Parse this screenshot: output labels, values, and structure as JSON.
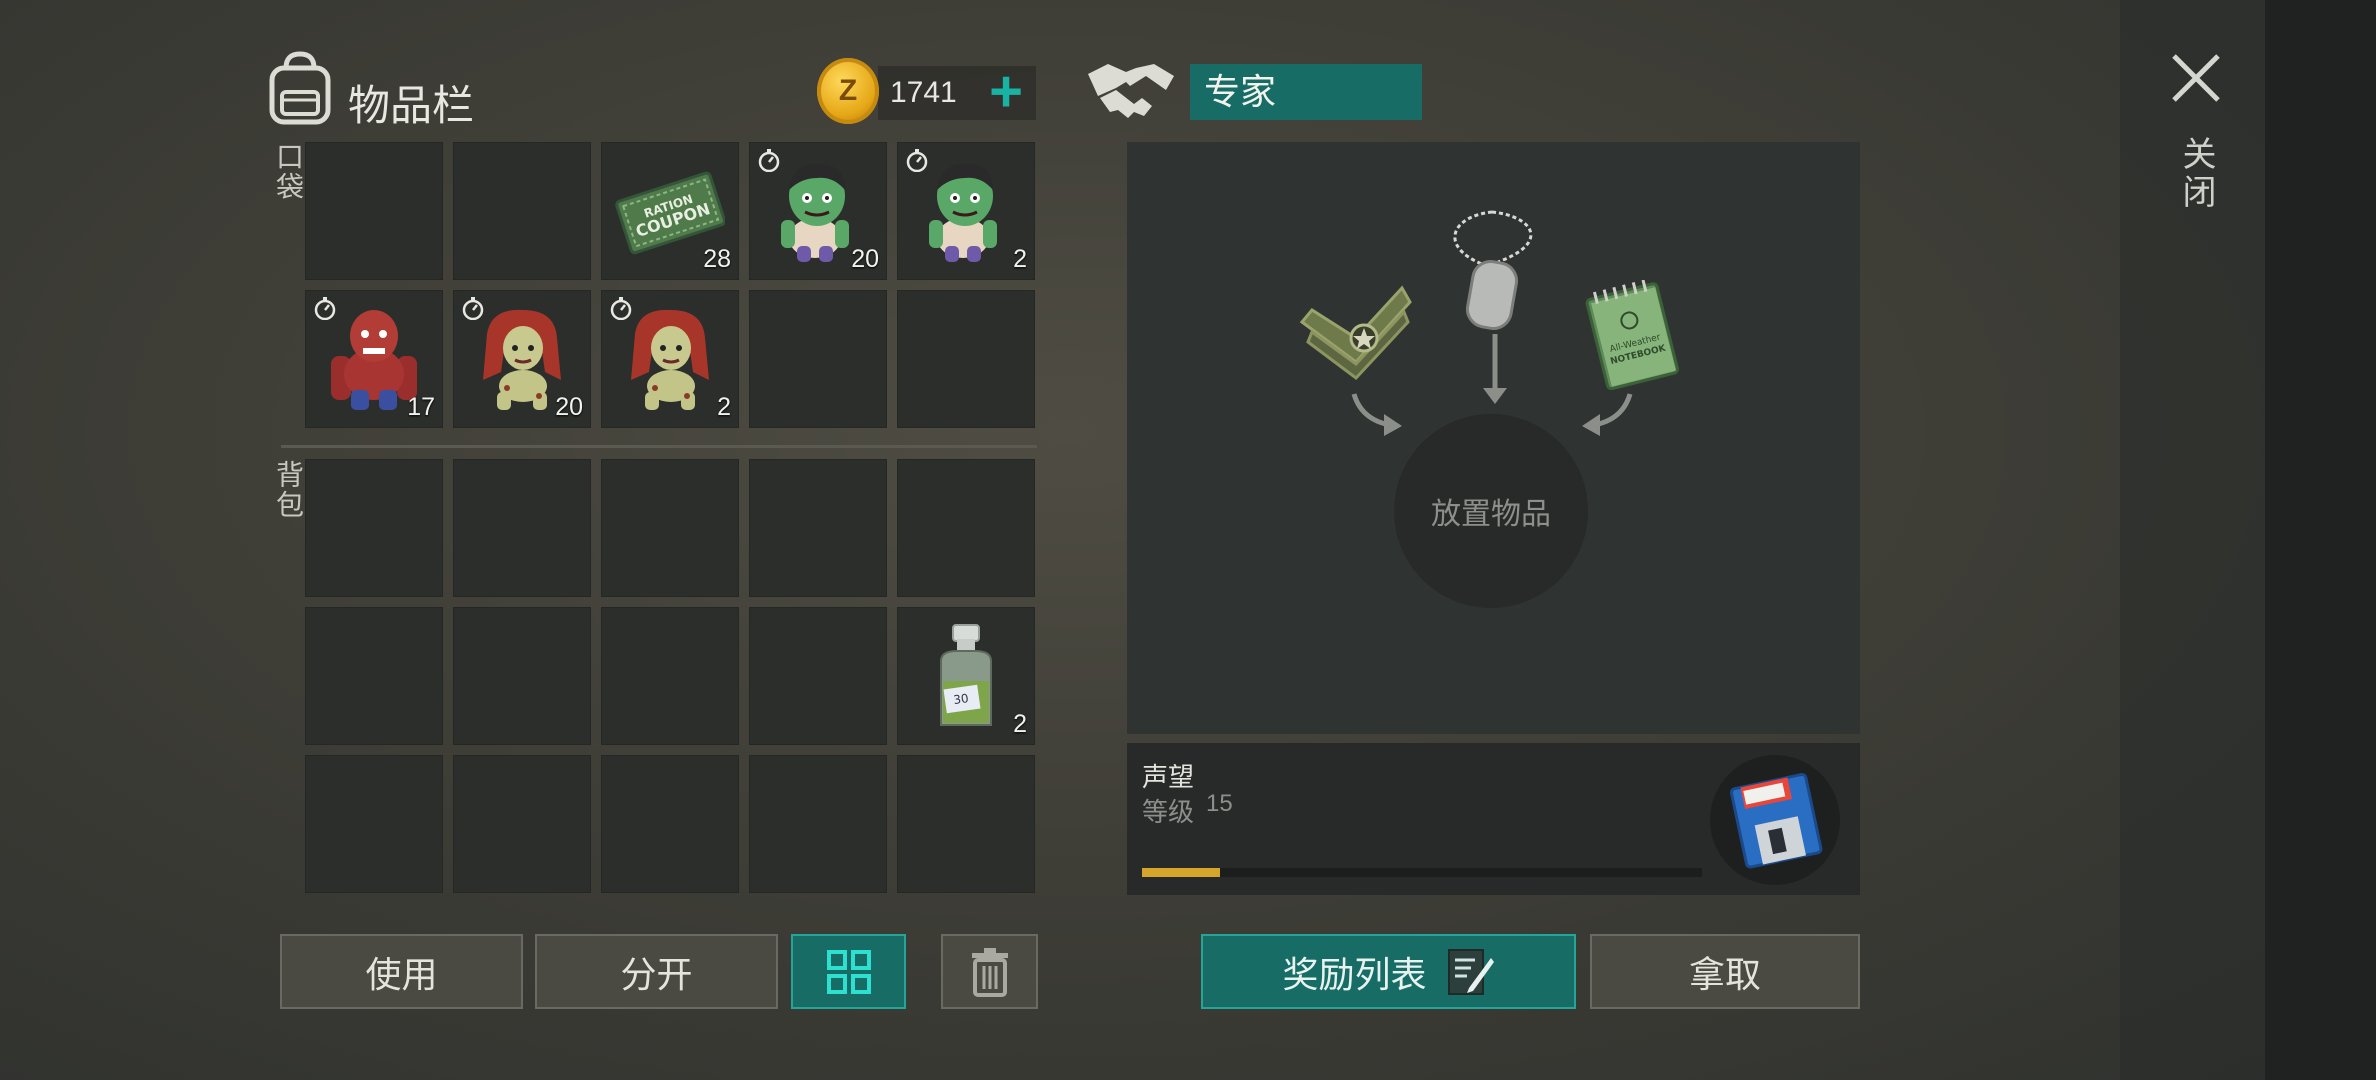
{
  "inventory": {
    "title": "物品栏",
    "coins": "1741",
    "pocket_label": "口袋",
    "backpack_label": "背包",
    "pocket_slots": [
      {
        "item": "",
        "qty": ""
      },
      {
        "item": "",
        "qty": ""
      },
      {
        "item": "ration-coupon",
        "qty": "28",
        "timer": false
      },
      {
        "item": "green-zombie-doll",
        "qty": "20",
        "timer": true
      },
      {
        "item": "green-zombie-doll",
        "qty": "2",
        "timer": true
      },
      {
        "item": "red-brute-zombie-doll",
        "qty": "17",
        "timer": true
      },
      {
        "item": "redhair-zombie-doll",
        "qty": "20",
        "timer": true
      },
      {
        "item": "redhair-zombie-doll",
        "qty": "2",
        "timer": true
      },
      {
        "item": "",
        "qty": ""
      },
      {
        "item": "",
        "qty": ""
      }
    ],
    "backpack_slots": [
      {
        "item": "",
        "qty": ""
      },
      {
        "item": "",
        "qty": ""
      },
      {
        "item": "",
        "qty": ""
      },
      {
        "item": "",
        "qty": ""
      },
      {
        "item": "",
        "qty": ""
      },
      {
        "item": "",
        "qty": ""
      },
      {
        "item": "",
        "qty": ""
      },
      {
        "item": "",
        "qty": ""
      },
      {
        "item": "",
        "qty": ""
      },
      {
        "item": "chemical-bottle",
        "qty": "2"
      },
      {
        "item": "",
        "qty": ""
      },
      {
        "item": "",
        "qty": ""
      },
      {
        "item": "",
        "qty": ""
      },
      {
        "item": "",
        "qty": ""
      },
      {
        "item": "",
        "qty": ""
      }
    ],
    "coupon_text": [
      "RATION",
      "COUPON"
    ],
    "bottle_label": "30"
  },
  "buttons": {
    "use": "使用",
    "split": "分开",
    "rewards": "奖励列表",
    "take": "拿取"
  },
  "trader": {
    "name": "专家",
    "drop_text": "放置物品",
    "notebook_text": [
      "All-Weather",
      "NOTEBOOK"
    ],
    "reputation_title": "声望",
    "level_label": "等级",
    "level_value": "15",
    "progress": 0.14
  },
  "close_label": "关闭",
  "colors": {
    "teal": "#176d66",
    "teal_bright": "#19b3a4",
    "gold": "#d5a62a"
  }
}
